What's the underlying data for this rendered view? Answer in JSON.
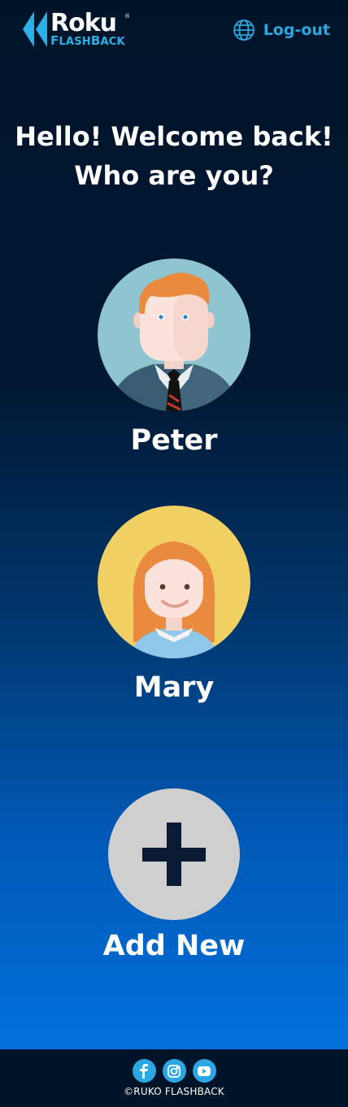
{
  "header": {
    "logo_roku": "Roku",
    "logo_tm": "®",
    "logo_flashback_f": "F",
    "logo_flashback_1": "LASH",
    "logo_flashback_b": "B",
    "logo_flashback_2": "ACK",
    "logout_label": "Log-out",
    "logout_icon": "globe-icon"
  },
  "welcome": {
    "line1": "Hello! Welcome back!",
    "line2": "Who are you?"
  },
  "profiles": [
    {
      "name": "Peter",
      "avatar": "male-avatar",
      "bg_color": "#8ec5d0"
    },
    {
      "name": "Mary",
      "avatar": "female-avatar",
      "bg_color": "#f0cf63"
    }
  ],
  "add_new": {
    "label": "Add New",
    "icon": "plus-icon"
  },
  "footer": {
    "social": [
      "facebook-icon",
      "instagram-icon",
      "youtube-icon"
    ],
    "copyright": "©RUKO FLASHBACK"
  },
  "colors": {
    "accent": "#2aa7e0",
    "footer_bg": "#001429"
  }
}
